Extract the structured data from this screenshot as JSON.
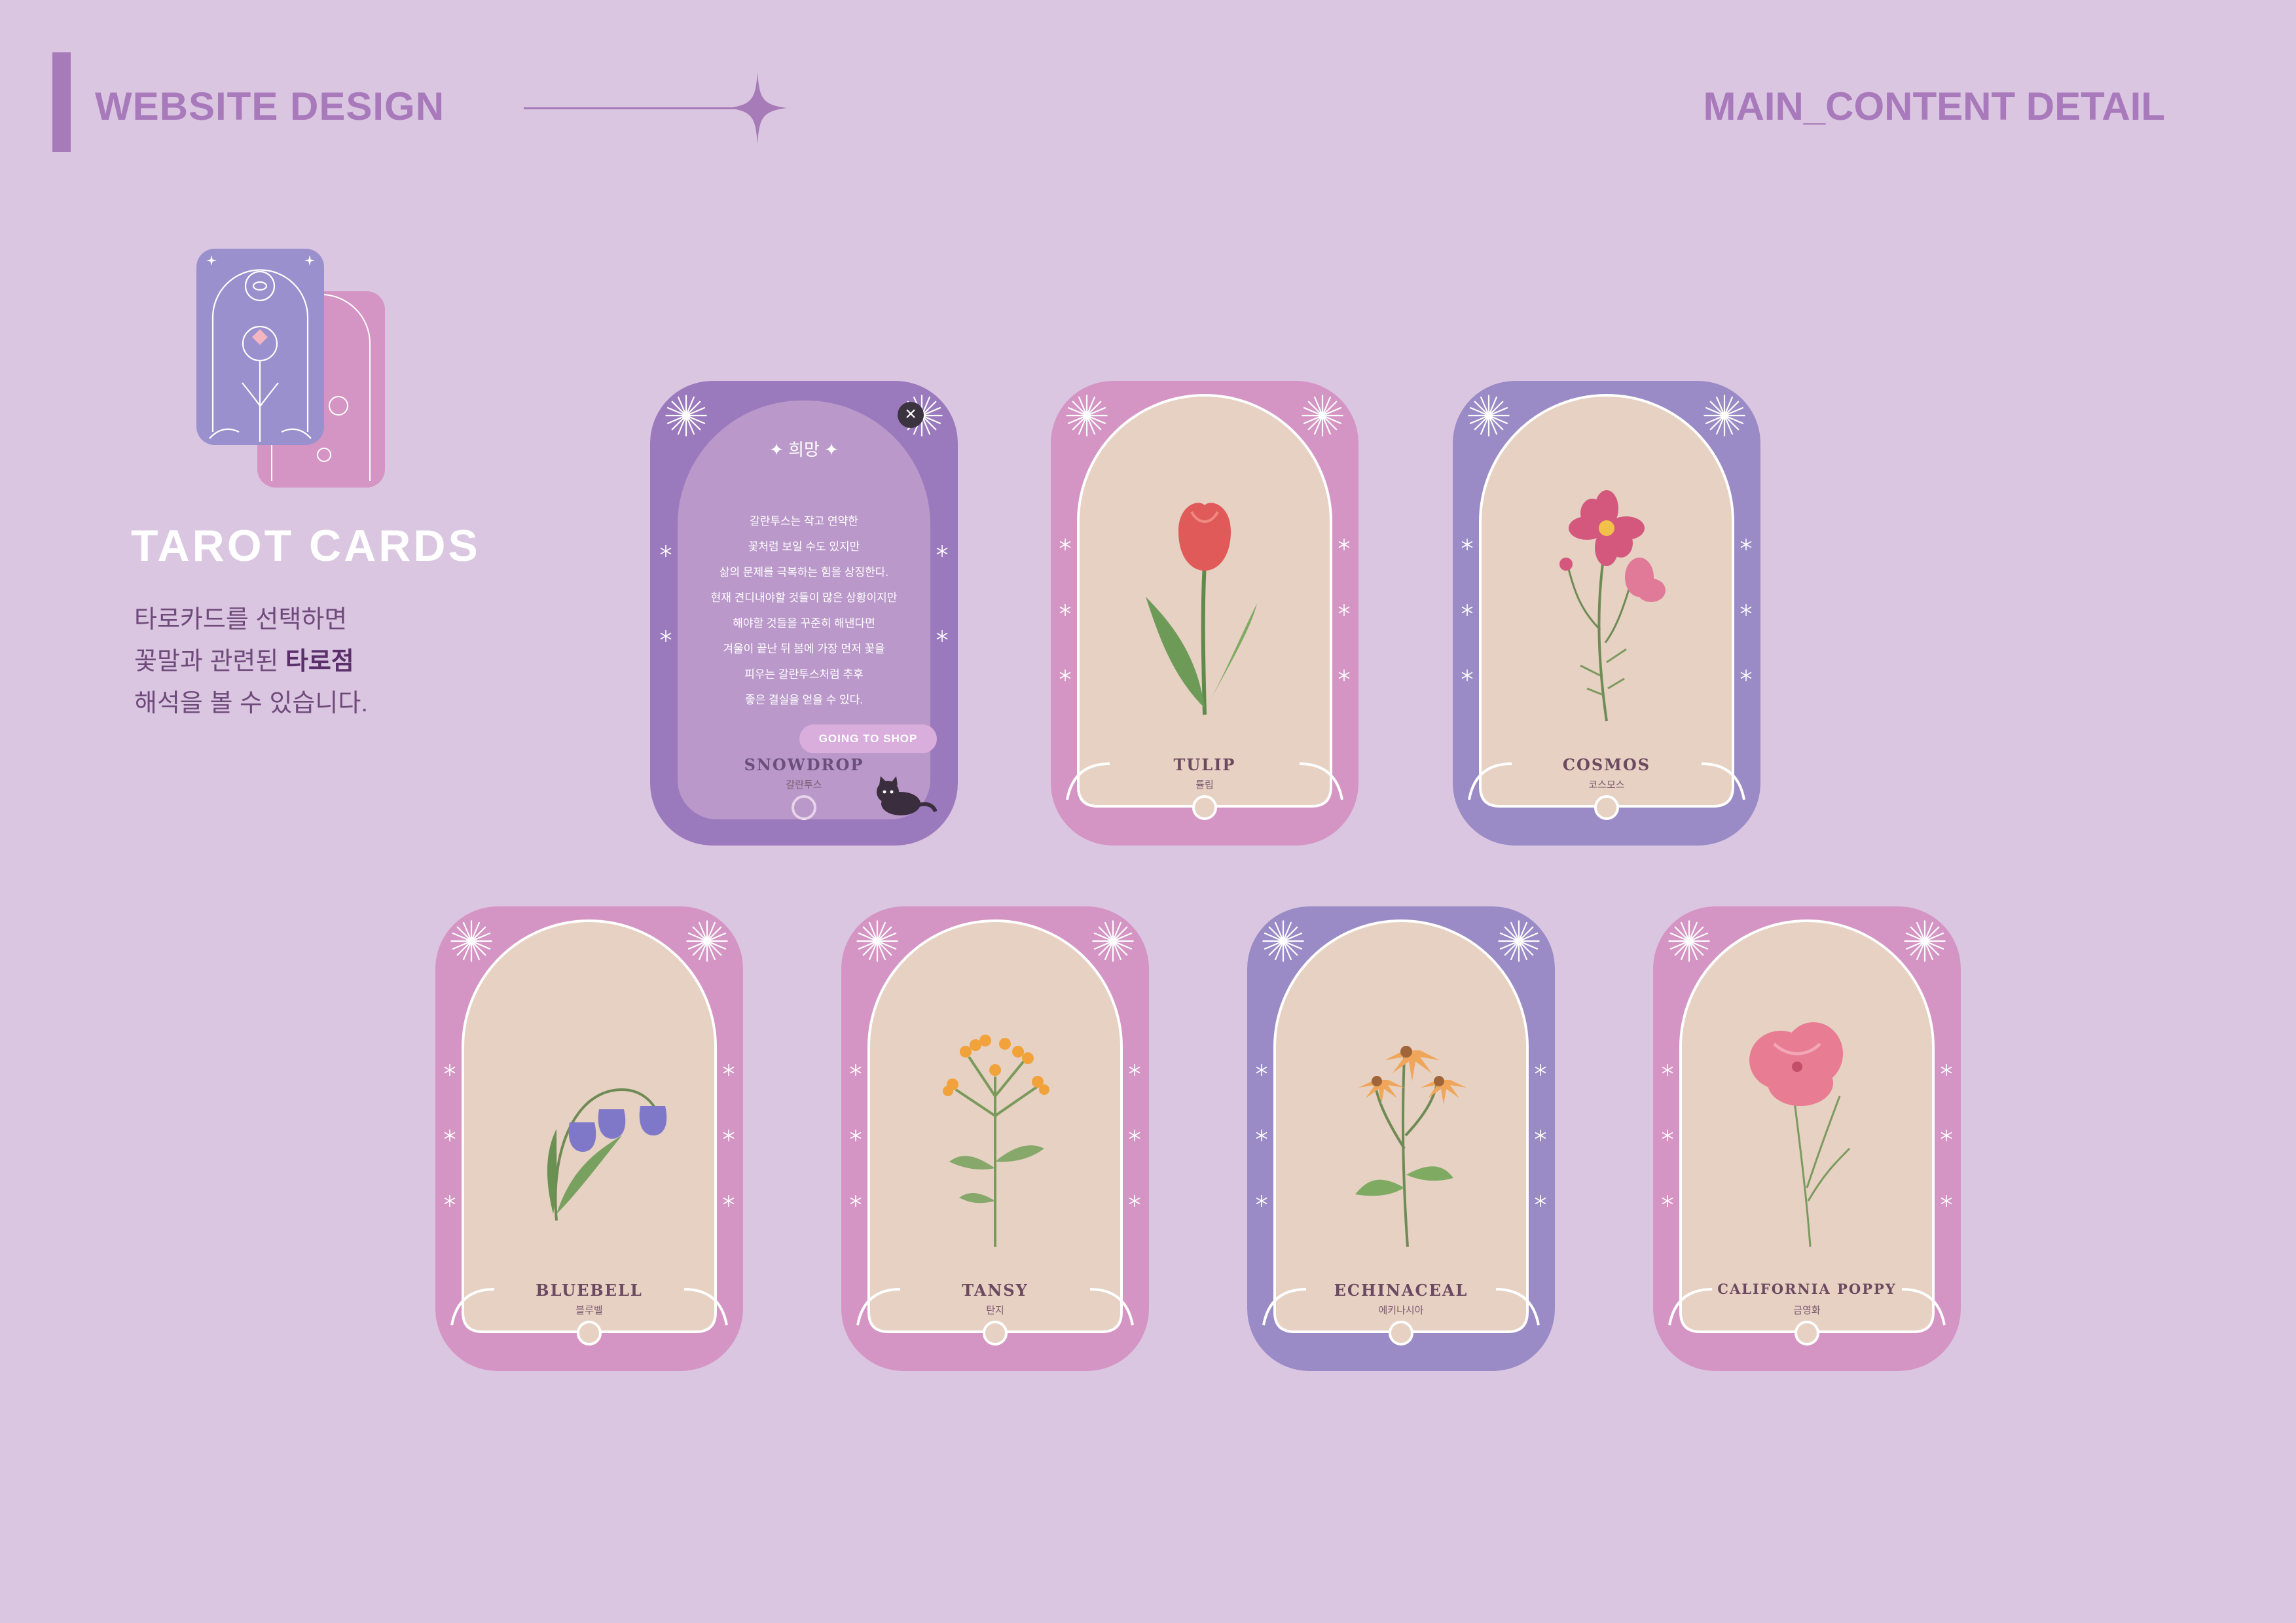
{
  "header": {
    "left_title": "WEBSITE DESIGN",
    "right_title": "MAIN_CONTENT DETAIL"
  },
  "intro": {
    "title": "TAROT CARDS",
    "desc_line1": "타로카드를 선택하면",
    "desc_line2_prefix": "꽃말과 관련된 ",
    "desc_line2_bold": "타로점",
    "desc_line3": "해석을 볼 수 있습니다."
  },
  "colors": {
    "background": "#dac6e1",
    "accent": "#a879bb",
    "purple_frame": "#9a8bc6",
    "pink_frame": "#d595c4",
    "card_inner": "#e6d1c3"
  },
  "open_card": {
    "title": "희망",
    "text_lines": [
      "갈란투스는 작고 연약한",
      "꽃처럼 보일 수도 있지만",
      "삶의 문제를 극복하는 힘을 상징한다.",
      "현재 견디내야할 것들이 많은 상황이지만",
      "해야할 것들을 꾸준히 해낸다면",
      "겨울이 끝난 뒤 봄에 가장 먼저 꽃을",
      "피우는 갈란투스처럼 추후",
      "좋은 결실을 얻을 수 있다."
    ],
    "button_label": "GOING TO SHOP",
    "name": "SNOWDROP",
    "sub": "갈란투스"
  },
  "cards": [
    {
      "name": "TULIP",
      "sub": "튤립",
      "frame": "pink",
      "icon": "tulip-icon"
    },
    {
      "name": "COSMOS",
      "sub": "코스모스",
      "frame": "purple",
      "icon": "cosmos-icon"
    },
    {
      "name": "BLUEBELL",
      "sub": "블루벨",
      "frame": "pink",
      "icon": "bluebell-icon"
    },
    {
      "name": "TANSY",
      "sub": "탄지",
      "frame": "pink",
      "icon": "tansy-icon"
    },
    {
      "name": "ECHINACEAL",
      "sub": "에키나시아",
      "frame": "purple",
      "icon": "echinacea-icon"
    },
    {
      "name": "CALIFORNIA POPPY",
      "sub": "금영화",
      "frame": "pink",
      "icon": "poppy-icon"
    }
  ]
}
